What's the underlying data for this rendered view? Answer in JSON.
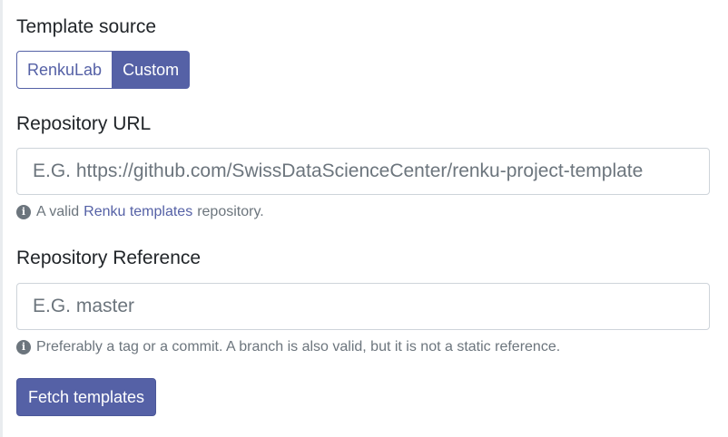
{
  "template_source": {
    "label": "Template source",
    "options": {
      "renkulab": "RenkuLab",
      "custom": "Custom"
    },
    "selected": "Custom"
  },
  "repository_url": {
    "label": "Repository URL",
    "value": "",
    "placeholder": "E.G. https://github.com/SwissDataScienceCenter/renku-project-template",
    "help": {
      "prefix": "A valid",
      "link_text": "Renku templates",
      "suffix": "repository."
    }
  },
  "repository_reference": {
    "label": "Repository Reference",
    "value": "",
    "placeholder": "E.G. master",
    "help": "Preferably a tag or a commit. A branch is also valid, but it is not a static reference."
  },
  "actions": {
    "fetch_label": "Fetch templates"
  },
  "colors": {
    "primary": "#5561a6",
    "muted": "#6c757d",
    "border": "#ced4da"
  },
  "icons": {
    "info": "info-circle-icon"
  }
}
